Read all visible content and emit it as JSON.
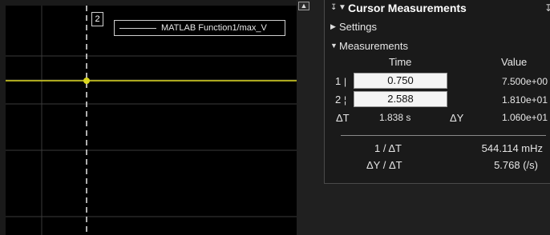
{
  "scope": {
    "cursor_tag": "2",
    "legend_label": "MATLAB Function1/max_V",
    "colors": {
      "background": "#000000",
      "grid": "#3a3a3a",
      "signal": "#d9d51e",
      "cursor": "#e8e8e8"
    }
  },
  "splitter": {
    "undock_icon": "undock-arrow-icon"
  },
  "panel": {
    "pin_icon": "pin-icon",
    "collapse_icon": "triangle-down-icon",
    "title": "Cursor Measurements",
    "more_icon": "more-icon",
    "settings": {
      "label": "Settings",
      "icon": "triangle-right-icon"
    },
    "measurements": {
      "label": "Measurements",
      "icon": "triangle-down-icon",
      "col_time": "Time",
      "col_value": "Value",
      "cursor1": {
        "label": "1",
        "time": "0.750",
        "value": "7.500e+00"
      },
      "cursor2": {
        "label": "2",
        "time": "2.588",
        "value": "1.810e+01"
      },
      "delta_t_label": "ΔT",
      "delta_t": "1.838 s",
      "delta_y_label": "ΔY",
      "delta_y": "1.060e+01",
      "inv_dt_label": "1 / ΔT",
      "inv_dt": "544.114 mHz",
      "slope_label": "ΔY / ΔT",
      "slope": "5.768 (/s)"
    }
  }
}
